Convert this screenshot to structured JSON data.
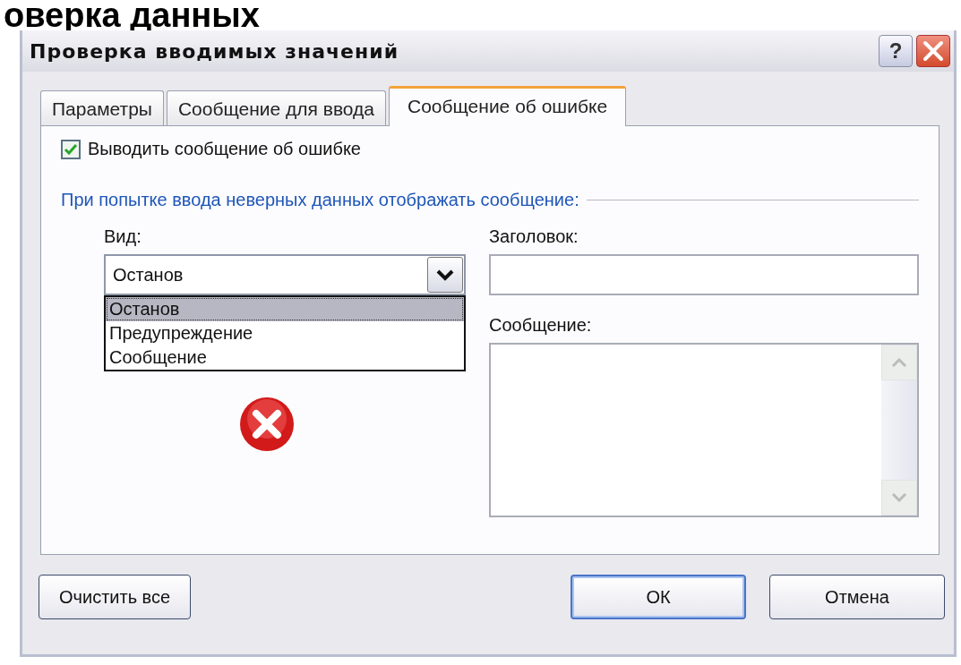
{
  "slide_title": "оверка данных",
  "window": {
    "title": "Проверка вводимых значений",
    "help_button": "?"
  },
  "tabs": [
    {
      "label": "Параметры",
      "selected": false
    },
    {
      "label": "Сообщение для ввода",
      "selected": false
    },
    {
      "label": "Сообщение об ошибке",
      "selected": true
    }
  ],
  "show_error": {
    "label": "Выводить сообщение об ошибке",
    "checked": true
  },
  "group_title": "При попытке ввода неверных данных отображать сообщение:",
  "style": {
    "label": "Вид:",
    "value": "Останов",
    "expanded": true,
    "options": [
      {
        "label": "Останов",
        "selected": true
      },
      {
        "label": "Предупреждение",
        "selected": false
      },
      {
        "label": "Сообщение",
        "selected": false
      }
    ]
  },
  "title_field": {
    "label": "Заголовок:"
  },
  "message_field": {
    "label": "Сообщение:"
  },
  "buttons": [
    {
      "label": "Очистить все",
      "default": false
    },
    {
      "label": "ОК",
      "default": true
    },
    {
      "label": "Отмена",
      "default": false
    }
  ]
}
